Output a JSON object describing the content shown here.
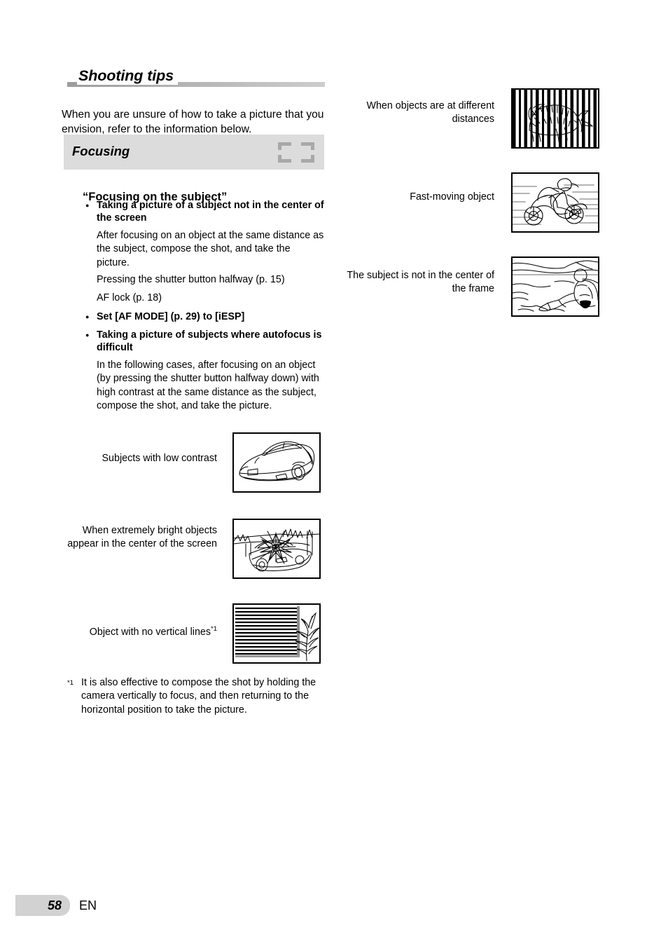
{
  "page": {
    "title": "Shooting tips",
    "intro": "When you are unsure of how to take a picture that you envision, refer to the information below.",
    "footer": {
      "page_number": "58",
      "language_code": "EN"
    }
  },
  "section": {
    "heading": "Focusing",
    "icon": "focus-bracket-icon",
    "icon_color": "#a8a8a8",
    "bar_color": "#dcdcdc",
    "subsection_heading": "“Focusing on the subject”"
  },
  "content": {
    "bullet_1": "Taking a picture of a subject not in the center of the screen",
    "para_1": "After focusing on an object at the same distance as the subject, compose the shot, and take the picture.",
    "para_2": "Pressing the shutter button halfway (p. 15)",
    "para_3": "AF lock (p. 18)",
    "bullet_2": "Set [AF MODE] (p. 29) to [iESP]",
    "bullet_3": "Taking a picture of subjects where autofocus is difficult",
    "para_4": "In the following cases, after focusing on an object (by pressing the shutter button halfway down) with high contrast at the same distance as the subject, compose the shot, and take the picture."
  },
  "illustrations": {
    "left_column": [
      {
        "caption": "Subjects with low contrast",
        "image": "car-line-art-illustration"
      },
      {
        "caption": "When extremely bright objects appear in the center of the screen",
        "image": "car-with-glare-illustration"
      },
      {
        "caption": "Object with no vertical lines",
        "caption_superscript": "*1",
        "image": "horizontal-blinds-plant-illustration"
      }
    ],
    "right_column": [
      {
        "caption": "When objects are at different distances",
        "image": "tiger-behind-bars-illustration"
      },
      {
        "caption": "Fast-moving object",
        "image": "motorcycle-speed-illustration"
      },
      {
        "caption": "The subject is not in the center of the frame",
        "image": "beach-person-off-center-illustration"
      }
    ]
  },
  "footnote": {
    "marker": "*1",
    "text": "It is also effective to compose the shot by holding the camera vertically to focus, and then returning to the horizontal position to take the picture."
  }
}
